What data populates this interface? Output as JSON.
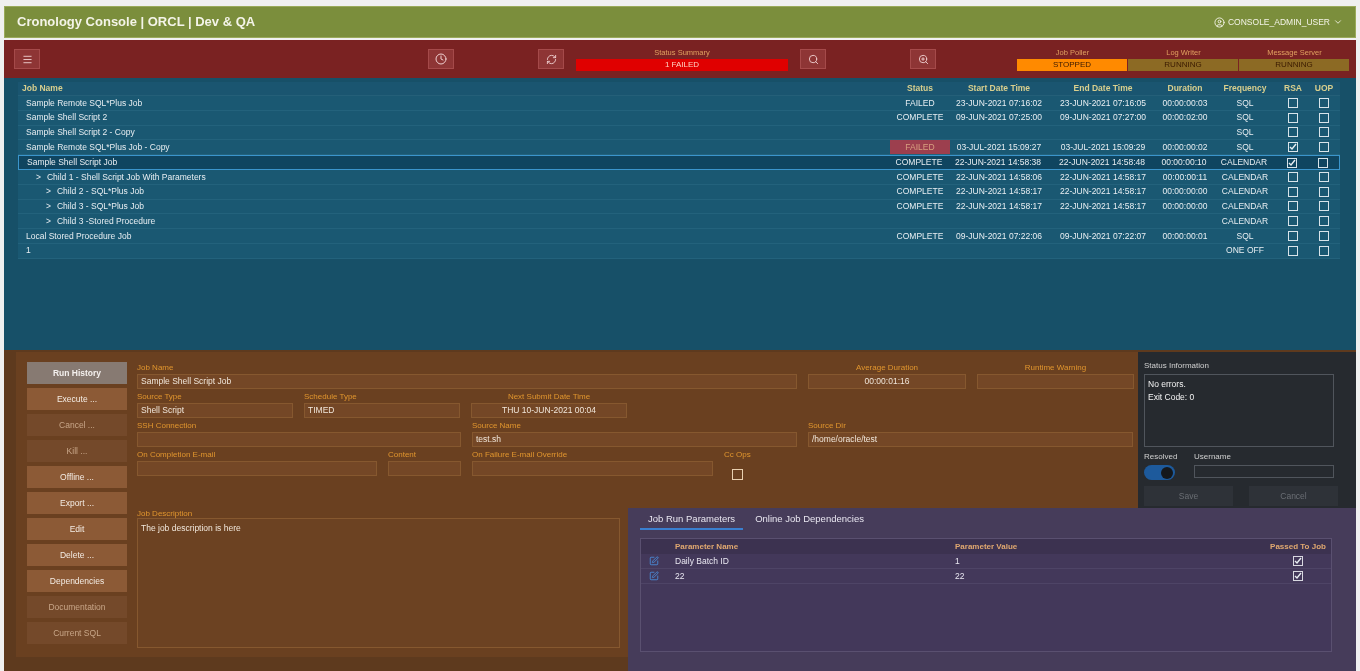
{
  "header": {
    "title": "Cronology Console | ORCL | Dev & QA",
    "user": "CONSOLE_ADMIN_USER"
  },
  "toolbar": {
    "status_summary": {
      "label": "Status Summary",
      "value": "1 FAILED",
      "color": "#e00000"
    },
    "indicators": [
      {
        "label": "Job Poller",
        "value": "STOPPED",
        "color": "#ff8a00"
      },
      {
        "label": "Log Writer",
        "value": "RUNNING",
        "color": "#8c6a24"
      },
      {
        "label": "Message Server",
        "value": "RUNNING",
        "color": "#8c6a24"
      }
    ]
  },
  "jobs_table": {
    "columns": [
      "Job Name",
      "Status",
      "Start Date Time",
      "End Date Time",
      "Duration",
      "Frequency",
      "RSA",
      "UOP"
    ],
    "rows": [
      {
        "name": "Sample Remote SQL*Plus Job",
        "status": "FAILED",
        "status_alert": false,
        "start": "23-JUN-2021 07:16:02",
        "end": "23-JUN-2021 07:16:05",
        "duration": "00:00:00:03",
        "frequency": "SQL",
        "rsa": false,
        "uop": false,
        "selected": false
      },
      {
        "name": "Sample Shell Script 2",
        "status": "COMPLETE",
        "status_alert": false,
        "start": "09-JUN-2021 07:25:00",
        "end": "09-JUN-2021 07:27:00",
        "duration": "00:00:02:00",
        "frequency": "SQL",
        "rsa": false,
        "uop": false,
        "selected": false
      },
      {
        "name": "Sample Shell Script 2 - Copy",
        "frequency": "SQL",
        "rsa": false,
        "uop": false,
        "selected": false
      },
      {
        "name": "Sample Remote SQL*Plus Job - Copy",
        "status": "FAILED",
        "status_alert": true,
        "start": "03-JUL-2021 15:09:27",
        "end": "03-JUL-2021 15:09:29",
        "duration": "00:00:00:02",
        "frequency": "SQL",
        "rsa": true,
        "uop": false,
        "selected": false
      },
      {
        "name": "Sample Shell Script Job",
        "status": "COMPLETE",
        "status_alert": false,
        "start": "22-JUN-2021 14:58:38",
        "end": "22-JUN-2021 14:58:48",
        "duration": "00:00:00:10",
        "frequency": "CALENDAR",
        "rsa": true,
        "uop": false,
        "selected": true,
        "children": [
          {
            "toggle": ">",
            "name": "Child 1 - Shell Script Job With Parameters",
            "status": "COMPLETE",
            "status_alert": false,
            "start": "22-JUN-2021 14:58:06",
            "end": "22-JUN-2021 14:58:17",
            "duration": "00:00:00:11",
            "frequency": "CALENDAR",
            "rsa": false,
            "uop": false,
            "selected": false,
            "children": [
              {
                "toggle": ">",
                "name": "Child 2 - SQL*Plus Job",
                "status": "COMPLETE",
                "status_alert": false,
                "start": "22-JUN-2021 14:58:17",
                "end": "22-JUN-2021 14:58:17",
                "duration": "00:00:00:00",
                "frequency": "CALENDAR",
                "rsa": false,
                "uop": false,
                "selected": false
              },
              {
                "toggle": ">",
                "name": "Child 3 - SQL*Plus Job",
                "status": "COMPLETE",
                "status_alert": false,
                "start": "22-JUN-2021 14:58:17",
                "end": "22-JUN-2021 14:58:17",
                "duration": "00:00:00:00",
                "frequency": "CALENDAR",
                "rsa": false,
                "uop": false,
                "selected": false
              },
              {
                "toggle": ">",
                "name": "Child 3 -Stored Procedure",
                "frequency": "CALENDAR",
                "rsa": false,
                "uop": false,
                "selected": false
              }
            ]
          }
        ]
      },
      {
        "name": "Local Stored Procedure Job",
        "status": "COMPLETE",
        "status_alert": false,
        "start": "09-JUN-2021 07:22:06",
        "end": "09-JUN-2021 07:22:07",
        "duration": "00:00:00:01",
        "frequency": "SQL",
        "rsa": false,
        "uop": false,
        "selected": false
      },
      {
        "name": "1",
        "frequency": "ONE OFF",
        "rsa": false,
        "uop": false,
        "selected": false
      }
    ]
  },
  "actions": [
    {
      "label": "Run History",
      "selected": true,
      "disabled": false
    },
    {
      "label": "Execute ...",
      "selected": false,
      "disabled": false
    },
    {
      "label": "Cancel ...",
      "selected": false,
      "disabled": true
    },
    {
      "label": "Kill ...",
      "selected": false,
      "disabled": true
    },
    {
      "label": "Offline ...",
      "selected": false,
      "disabled": false
    },
    {
      "label": "Export ...",
      "selected": false,
      "disabled": false
    },
    {
      "label": "Edit",
      "selected": false,
      "disabled": false
    },
    {
      "label": "Delete ...",
      "selected": false,
      "disabled": false
    },
    {
      "label": "Dependencies",
      "selected": false,
      "disabled": false
    },
    {
      "label": "Documentation",
      "selected": false,
      "disabled": true
    },
    {
      "label": "Current SQL",
      "selected": false,
      "disabled": true
    }
  ],
  "details": {
    "rows": [
      [
        {
          "label": "Job Name",
          "value": "Sample Shell Script Job"
        },
        {
          "label": "Average Duration",
          "value": "00:00:01:16",
          "centered": true
        },
        {
          "label": "Runtime Warning",
          "centered": true
        }
      ],
      [
        {
          "label": "Source Type",
          "value": "Shell Script"
        },
        {
          "label": "Schedule Type",
          "value": "TIMED"
        },
        {
          "label": "Next Submit Date Time",
          "value": "THU 10-JUN-2021 00:04",
          "centered": true
        }
      ],
      [
        {
          "label": "SSH Connection"
        },
        {
          "label": "Source Name",
          "value": "test.sh"
        },
        {
          "label": "Source Dir",
          "value": "/home/oracle/test"
        }
      ],
      [
        {
          "label": "On Completion E-mail"
        },
        {
          "label": "Content"
        },
        {
          "label": "On Failure E-mail Override"
        },
        {
          "kind": "checkbox",
          "label": "Cc Ops",
          "checked": false
        }
      ]
    ],
    "description": {
      "label": "Job Description",
      "value": "The job description is here"
    }
  },
  "status_info": {
    "label": "Status Information",
    "value": "No errors.\nExit Code: 0",
    "resolved_label": "Resolved",
    "resolved": true,
    "username_label": "Username",
    "buttons": [
      "Save",
      "Cancel"
    ]
  },
  "params": {
    "tabs": [
      {
        "label": "Job Run Parameters",
        "selected": true
      },
      {
        "label": "Online Job Dependencies",
        "selected": false
      }
    ],
    "columns": [
      "Parameter Name",
      "Parameter Value",
      "Passed To Job"
    ],
    "rows": [
      {
        "name": "Daily Batch ID",
        "value": "1",
        "passed": true
      },
      {
        "name": "22",
        "value": "22",
        "passed": true
      }
    ]
  }
}
